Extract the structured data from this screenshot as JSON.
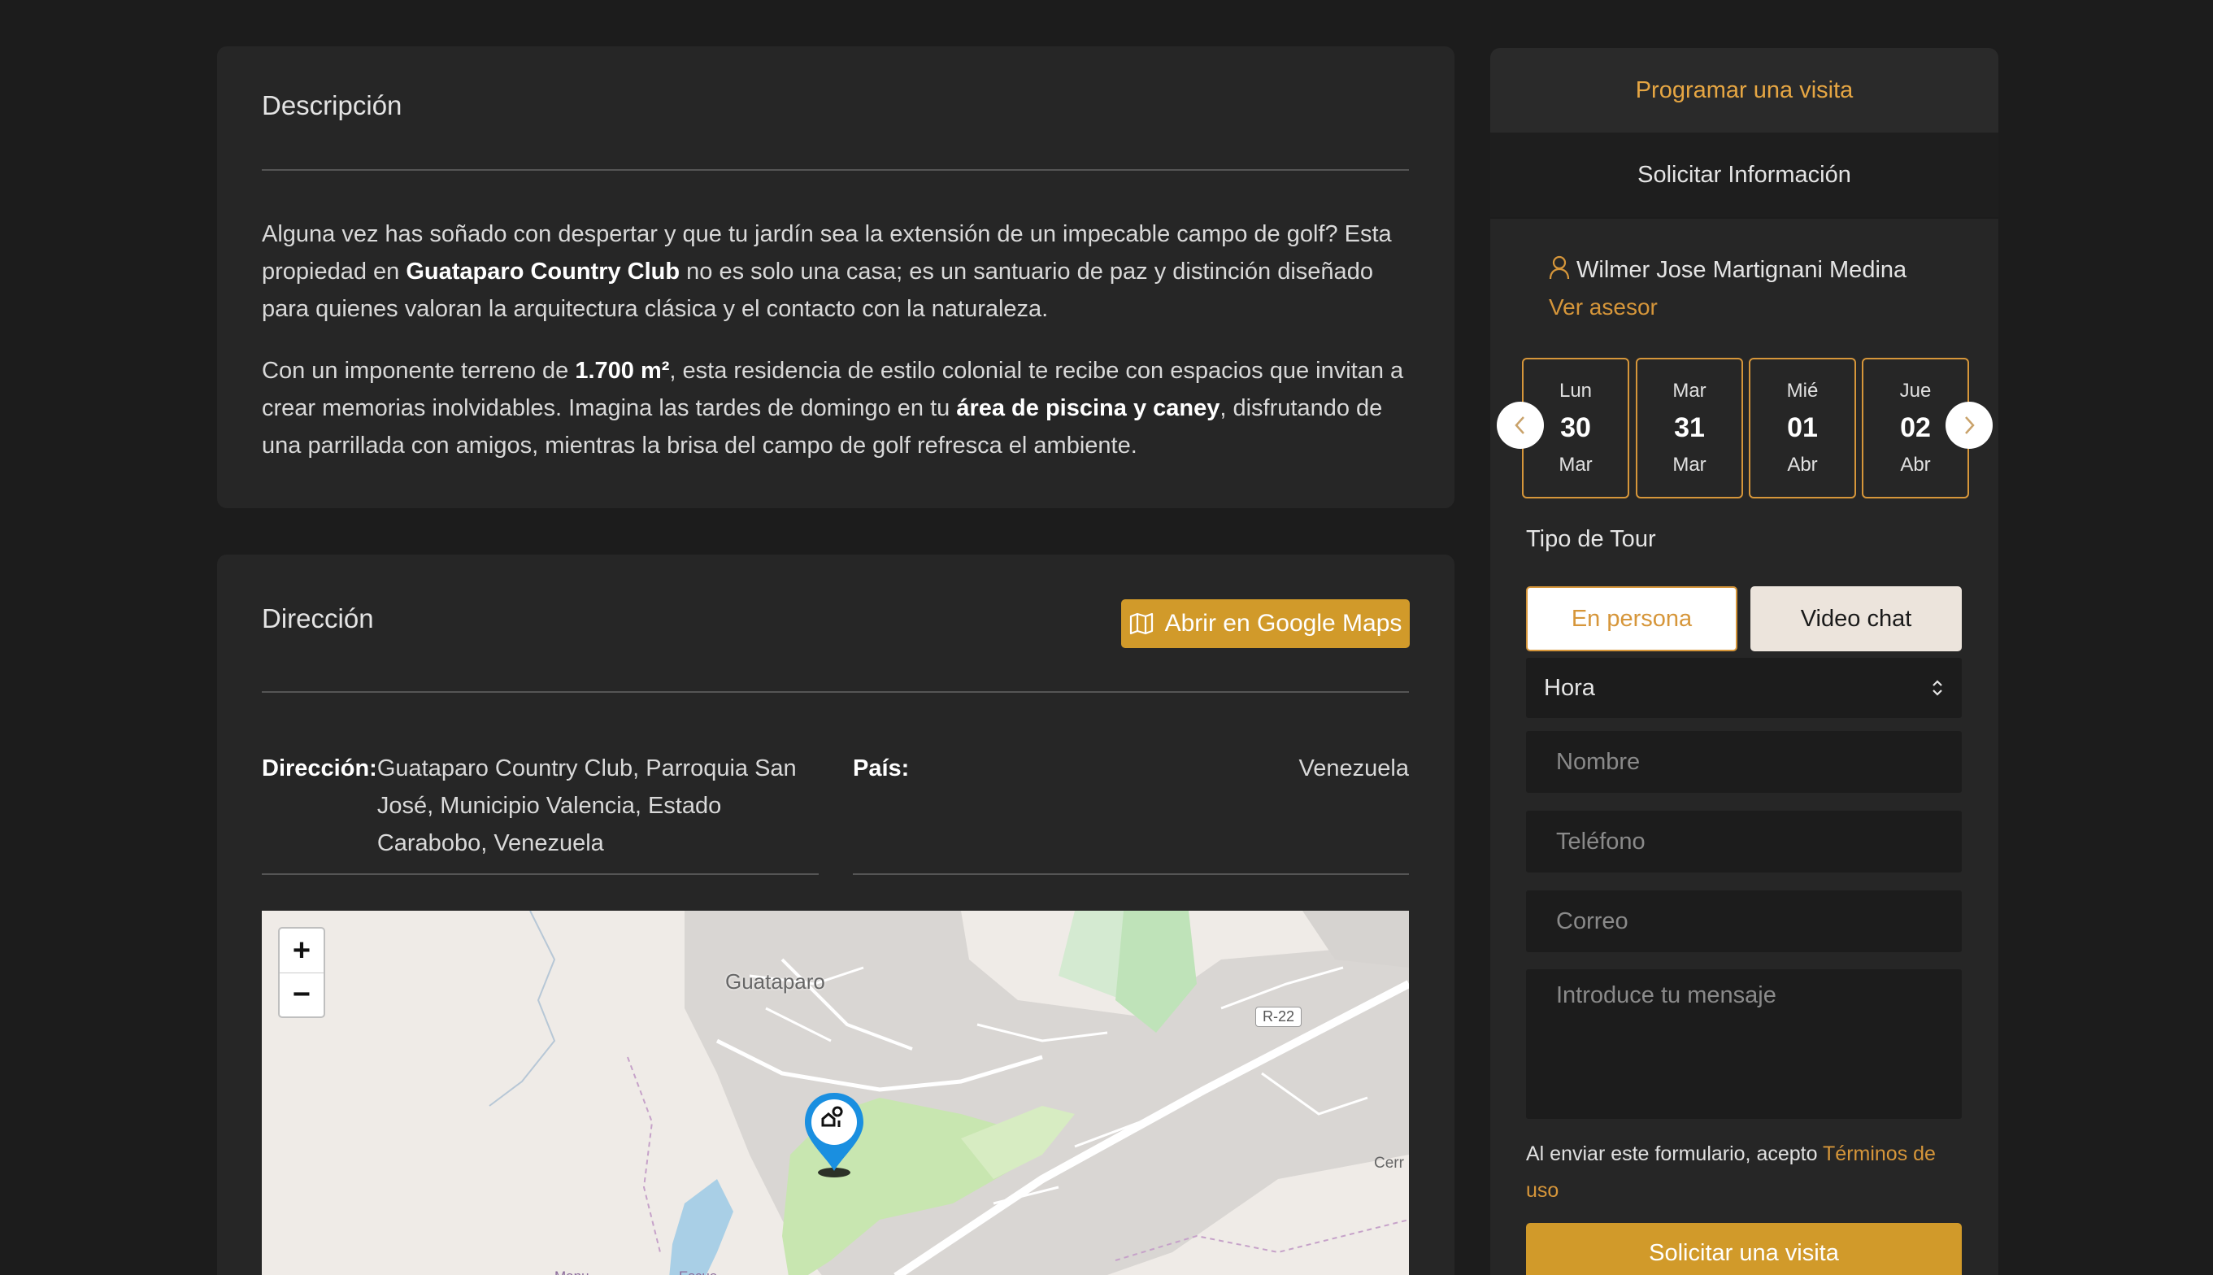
{
  "description": {
    "title": "Descripción",
    "p1_a": "Alguna vez has soñado con despertar y que tu jardín sea la extensión de un impecable campo de golf? Esta propiedad en ",
    "p1_b": "Guataparo Country Club",
    "p1_c": " no es solo una casa; es un santuario de paz y distinción diseñado para quienes valoran la arquitectura clásica y el contacto con la naturaleza.",
    "p2_a": "Con un imponente terreno de ",
    "p2_b": "1.700 m²",
    "p2_c": ", esta residencia de estilo colonial te recibe con espacios que invitan a crear memorias inolvidables. Imagina las tardes de domingo en tu ",
    "p2_d": "área de piscina y caney",
    "p2_e": ", disfrutando de una parrillada con amigos, mientras la brisa del campo de golf refresca el ambiente."
  },
  "address": {
    "title": "Dirección",
    "maps_button": "Abrir en Google Maps",
    "address_label": "Dirección:",
    "address_value": "Guataparo Country Club, Parroquia San José, Municipio Valencia, Estado Carabobo, Venezuela",
    "country_label": "País:",
    "country_value": "Venezuela"
  },
  "map": {
    "zoom_in": "+",
    "zoom_out": "−",
    "place_guataparo": "Guataparo",
    "road_label": "R-22",
    "place_cerro": "Cerr",
    "place_manu": "Manu",
    "place_escue": "Escue",
    "pin_icon": "home-pin-icon"
  },
  "sidebar": {
    "tab_visit": "Programar una visita",
    "tab_info": "Solicitar Información",
    "agent_name": "Wilmer Jose Martignani Medina",
    "agent_link": "Ver asesor",
    "days": [
      {
        "name": "Lun",
        "day": "30",
        "month": "Mar"
      },
      {
        "name": "Mar",
        "day": "31",
        "month": "Mar"
      },
      {
        "name": "Mié",
        "day": "01",
        "month": "Abr"
      },
      {
        "name": "Jue",
        "day": "02",
        "month": "Abr"
      }
    ],
    "tour_label": "Tipo de Tour",
    "tour_person": "En persona",
    "tour_video": "Video chat",
    "hour_select": "Hora",
    "name_placeholder": "Nombre",
    "phone_placeholder": "Teléfono",
    "email_placeholder": "Correo",
    "message_placeholder": "Introduce tu mensaje",
    "terms_text": "Al enviar este formulario, acepto ",
    "terms_link": "Términos de uso",
    "submit": "Solicitar una visita"
  },
  "colors": {
    "accent": "#d19a2a",
    "background": "#1c1c1c",
    "card": "#262626"
  }
}
